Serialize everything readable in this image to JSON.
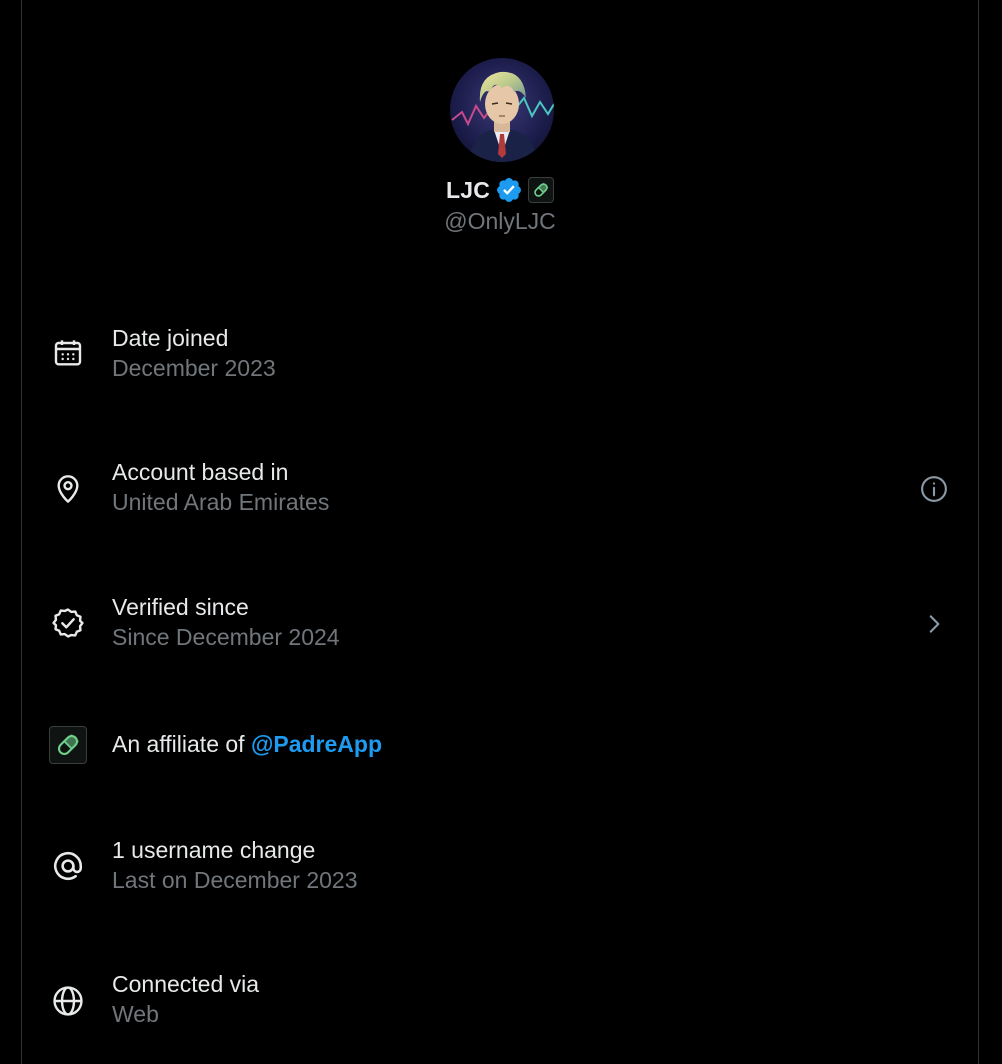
{
  "profile": {
    "display_name": "LJC",
    "handle": "@OnlyLJC",
    "verified": true
  },
  "rows": [
    {
      "icon": "calendar-icon",
      "title": "Date joined",
      "subtitle": "December 2023"
    },
    {
      "icon": "location-pin-icon",
      "title": "Account based in",
      "subtitle": "United Arab Emirates",
      "trailing": "info-icon"
    },
    {
      "icon": "verified-seal-icon",
      "title": "Verified since",
      "subtitle": "Since December 2024",
      "trailing": "chevron-right-icon"
    },
    {
      "icon": "affiliate-pill-icon",
      "title_prefix": "An affiliate of ",
      "mention": "@PadreApp"
    },
    {
      "icon": "at-sign-icon",
      "title": "1 username change",
      "subtitle": "Last on December 2023"
    },
    {
      "icon": "globe-icon",
      "title": "Connected via",
      "subtitle": "Web"
    }
  ],
  "colors": {
    "background": "#000000",
    "text_primary": "#e7e9ea",
    "text_secondary": "#71767b",
    "link": "#1d9bf0",
    "verified_blue": "#1d9bf0",
    "affiliate_green": "#6fd08c"
  }
}
